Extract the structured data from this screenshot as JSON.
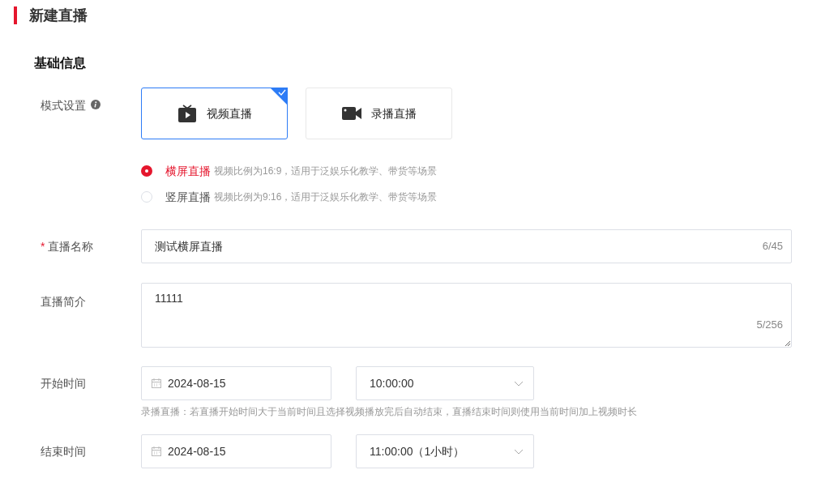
{
  "page_title": "新建直播",
  "section_title": "基础信息",
  "mode": {
    "label": "模式设置",
    "options": [
      {
        "kind": "video",
        "label": "视频直播",
        "selected": true
      },
      {
        "kind": "record",
        "label": "录播直播",
        "selected": false
      }
    ]
  },
  "orientations": [
    {
      "label": "横屏直播",
      "description": "视频比例为16:9，适用于泛娱乐化教学、带货等场景",
      "selected": true
    },
    {
      "label": "竖屏直播",
      "description": "视频比例为9:16，适用于泛娱乐化教学、带货等场景",
      "selected": false
    }
  ],
  "name": {
    "label": "直播名称",
    "required_mark": "*",
    "value": "测试横屏直播",
    "count": "6/45"
  },
  "intro": {
    "label": "直播简介",
    "value": "11111",
    "count": "5/256"
  },
  "start": {
    "label": "开始时间",
    "date": "2024-08-15",
    "time": "10:00:00",
    "hint": "录播直播：若直播开始时间大于当前时间且选择视频播放完后自动结束，直播结束时间则使用当前时间加上视频时长"
  },
  "end": {
    "label": "结束时间",
    "date": "2024-08-15",
    "time": "11:00:00（1小时）"
  }
}
